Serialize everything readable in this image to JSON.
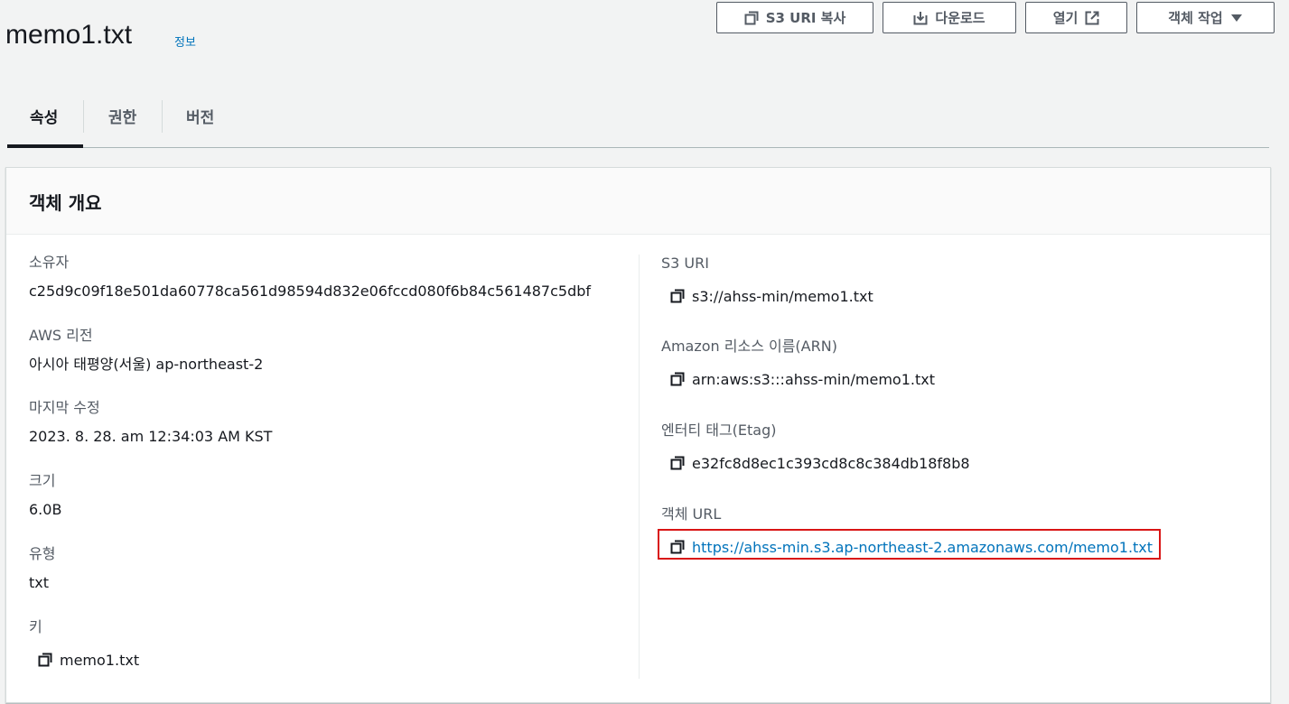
{
  "header": {
    "title": "memo1.txt",
    "info_link": "정보"
  },
  "toolbar": {
    "copy_uri_label": "S3 URI 복사",
    "download_label": "다운로드",
    "open_label": "열기",
    "actions_label": "객체 작업"
  },
  "tabs": [
    {
      "label": "속성",
      "active": true
    },
    {
      "label": "권한",
      "active": false
    },
    {
      "label": "버전",
      "active": false
    }
  ],
  "overview": {
    "title": "객체 개요",
    "owner": {
      "label": "소유자",
      "value": "c25d9c09f18e501da60778ca561d98594d832e06fccd080f6b84c561487c5dbf"
    },
    "region": {
      "label": "AWS 리전",
      "value": "아시아 태평양(서울) ap-northeast-2"
    },
    "last_modified": {
      "label": "마지막 수정",
      "value": "2023. 8. 28. am 12:34:03 AM KST"
    },
    "size": {
      "label": "크기",
      "value": "6.0B"
    },
    "type": {
      "label": "유형",
      "value": "txt"
    },
    "key": {
      "label": "키",
      "value": "memo1.txt"
    },
    "s3_uri": {
      "label": "S3 URI",
      "value": "s3://ahss-min/memo1.txt"
    },
    "arn": {
      "label": "Amazon 리소스 이름(ARN)",
      "value": "arn:aws:s3:::ahss-min/memo1.txt"
    },
    "etag": {
      "label": "엔터티 태그(Etag)",
      "value": "e32fc8d8ec1c393cd8c8c384db18f8b8"
    },
    "object_url": {
      "label": "객체 URL",
      "value": "https://ahss-min.s3.ap-northeast-2.amazonaws.com/memo1.txt"
    }
  },
  "colors": {
    "link": "#0073bb",
    "highlight": "#d91515",
    "text": "#16191f",
    "muted": "#545b64"
  },
  "icons": {
    "copy": "copy-icon",
    "download": "download-icon",
    "external": "external-link-icon",
    "caret": "caret-down-icon"
  }
}
